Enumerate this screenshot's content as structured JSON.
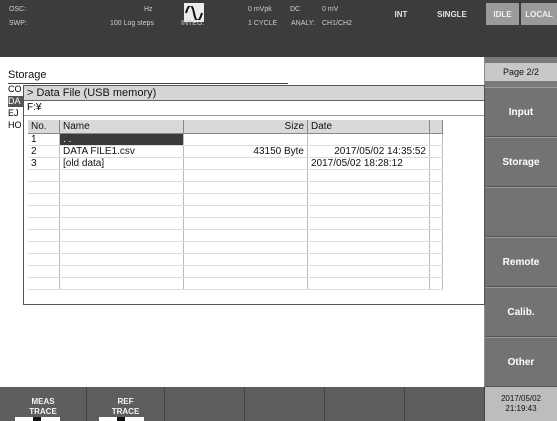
{
  "header": {
    "osc_label": "OSC:",
    "osc_freq_unit": "Hz",
    "osc_amp": "0 mVpk",
    "osc_dc_label": "DC",
    "osc_dc_value": "0 mV",
    "swp_label": "SWP:",
    "swp_value": "100 Log steps",
    "integ_label": "INTEG:",
    "integ_value": "1 CYCLE",
    "analy_label": "ANALY:",
    "analy_value": "CH1/CH2",
    "btn_int": "INT",
    "btn_single": "SINGLE",
    "btn_idle": "IDLE",
    "btn_local": "LOCAL",
    "wave_icon": "sine-wave-icon"
  },
  "storage": {
    "title": "Storage",
    "side_items": [
      "CO",
      "DA",
      "EJ",
      "HO"
    ]
  },
  "dialog": {
    "title": "> Data File (USB memory)",
    "path": "F:¥",
    "columns": [
      "No.",
      "Name",
      "Size",
      "Date"
    ],
    "rows": [
      {
        "no": "1",
        "name": ". .",
        "size": "",
        "date": ""
      },
      {
        "no": "2",
        "name": "DATA FILE1.csv",
        "size": "43150 Byte",
        "date": "2017/05/02 14:35:52"
      },
      {
        "no": "3",
        "name": "[old data]",
        "size": "",
        "date": "2017/05/02 18:28:12"
      }
    ]
  },
  "sidebar": {
    "page": "Page 2/2",
    "buttons": [
      "Input",
      "Storage",
      "",
      "Remote",
      "Calib.",
      "Other"
    ]
  },
  "bottom": {
    "meas_trace": "MEAS\nTRACE",
    "meas_line1": "MEAS",
    "meas_line2": "TRACE",
    "ref_line1": "REF",
    "ref_line2": "TRACE"
  },
  "clock": {
    "date": "2017/05/02",
    "time": "21:19:43"
  }
}
